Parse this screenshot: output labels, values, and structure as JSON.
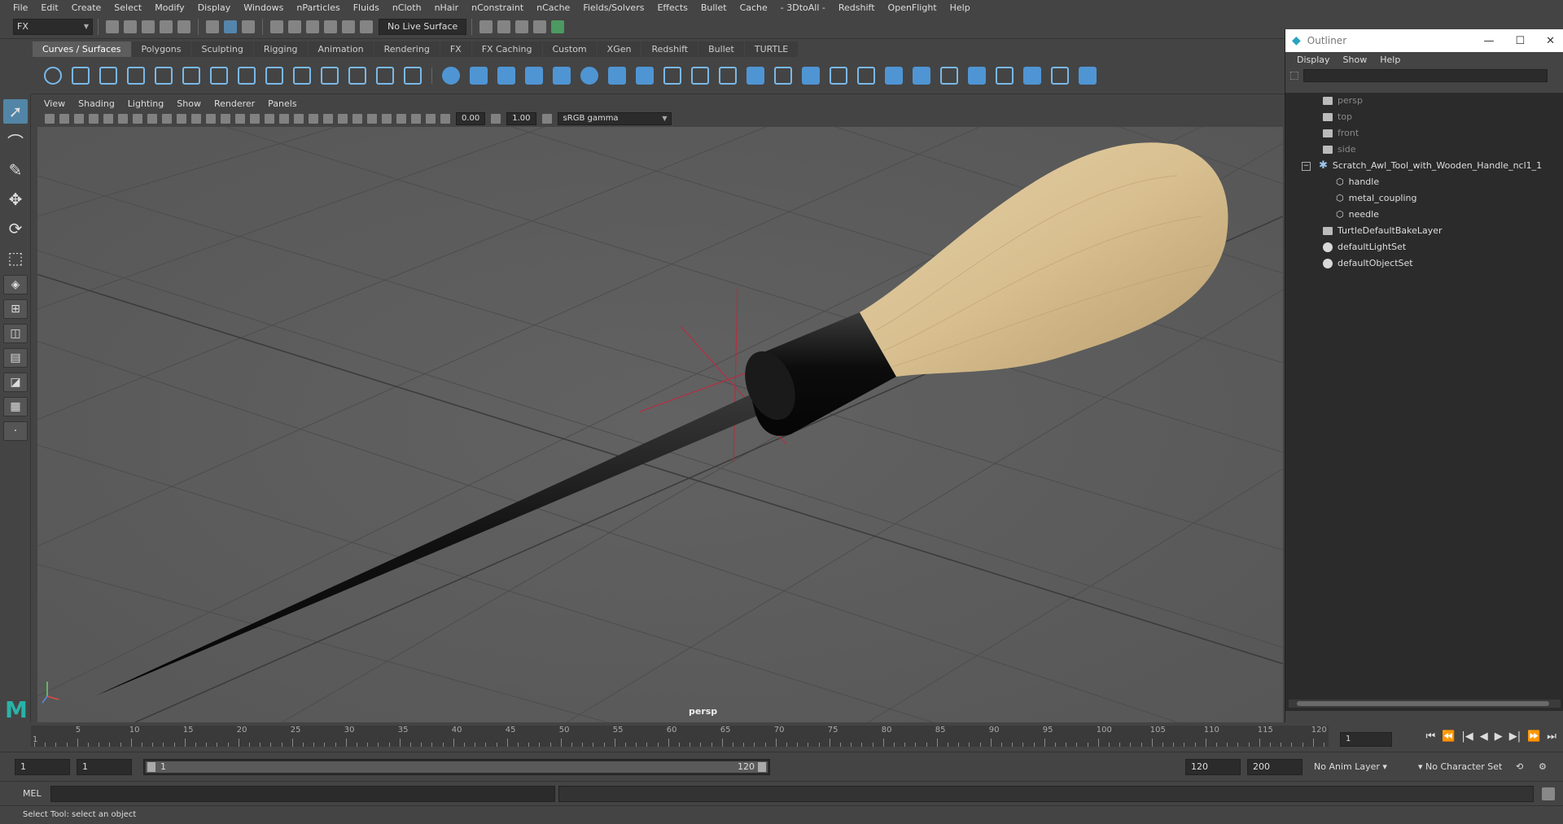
{
  "menubar": [
    "File",
    "Edit",
    "Create",
    "Select",
    "Modify",
    "Display",
    "Windows",
    "nParticles",
    "Fluids",
    "nCloth",
    "nHair",
    "nConstraint",
    "nCache",
    "Fields/Solvers",
    "Effects",
    "Bullet",
    "Cache",
    "- 3DtoAll -",
    "Redshift",
    "OpenFlight",
    "Help"
  ],
  "statusline": {
    "mode": "FX",
    "live_surface": "No Live Surface"
  },
  "shelf_tabs": [
    "Curves / Surfaces",
    "Polygons",
    "Sculpting",
    "Rigging",
    "Animation",
    "Rendering",
    "FX",
    "FX Caching",
    "Custom",
    "XGen",
    "Redshift",
    "Bullet",
    "TURTLE"
  ],
  "shelf_active_tab": "Curves / Surfaces",
  "viewport": {
    "menu": [
      "View",
      "Shading",
      "Lighting",
      "Show",
      "Renderer",
      "Panels"
    ],
    "exposure": "0.00",
    "gamma_value": "1.00",
    "color_space": "sRGB gamma",
    "camera_label": "persp"
  },
  "outliner": {
    "title": "Outliner",
    "window_buttons": [
      "—",
      "☐",
      "✕"
    ],
    "menu": [
      "Display",
      "Show",
      "Help"
    ],
    "items": [
      {
        "label": "persp",
        "type": "camera",
        "dim": true
      },
      {
        "label": "top",
        "type": "camera",
        "dim": true
      },
      {
        "label": "front",
        "type": "camera",
        "dim": true
      },
      {
        "label": "side",
        "type": "camera",
        "dim": true
      },
      {
        "label": "Scratch_Awl_Tool_with_Wooden_Handle_ncl1_1",
        "type": "group"
      },
      {
        "label": "handle",
        "type": "mesh"
      },
      {
        "label": "metal_coupling",
        "type": "mesh"
      },
      {
        "label": "needle",
        "type": "mesh"
      },
      {
        "label": "TurtleDefaultBakeLayer",
        "type": "layer"
      },
      {
        "label": "defaultLightSet",
        "type": "set"
      },
      {
        "label": "defaultObjectSet",
        "type": "set"
      }
    ]
  },
  "timeline": {
    "ticks": [
      "5",
      "10",
      "15",
      "20",
      "25",
      "30",
      "35",
      "40",
      "45",
      "50",
      "55",
      "60",
      "65",
      "70",
      "75",
      "80",
      "85",
      "90",
      "95",
      "100",
      "105",
      "110",
      "115",
      "120"
    ],
    "start_marker": "1",
    "current_frame": "1",
    "playback_buttons": [
      "⏮",
      "⏪",
      "|◀",
      "◀",
      "▶",
      "▶|",
      "⏩",
      "⏭"
    ]
  },
  "range": {
    "start": "1",
    "playback_start": "1",
    "slider_start": "1",
    "slider_end": "120",
    "playback_end": "120",
    "end": "200",
    "anim_layer": "No Anim Layer",
    "character_set": "No Character Set"
  },
  "commandline": {
    "label": "MEL"
  },
  "helpline": "Select Tool: select an object"
}
